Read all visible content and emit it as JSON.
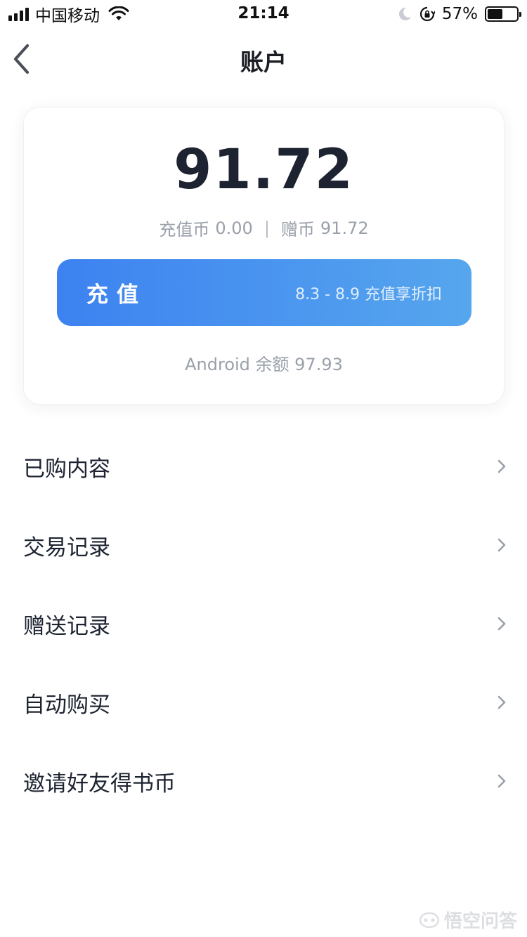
{
  "status_bar": {
    "carrier": "中国移动",
    "time": "21:14",
    "battery_percent": "57%",
    "battery_level": 0.57,
    "icons": [
      "signal-icon",
      "wifi-icon",
      "moon-icon",
      "rotation-lock-icon",
      "battery-icon"
    ]
  },
  "nav": {
    "title": "账户",
    "back_icon": "chevron-left-icon"
  },
  "account": {
    "balance": "91.72",
    "recharge_coins_label": "充值币",
    "recharge_coins_value": "0.00",
    "separator": "|",
    "gift_coins_label": "赠币",
    "gift_coins_value": "91.72",
    "recharge_button_label": "充值",
    "recharge_promo": "8.3 - 8.9 充值享折扣",
    "android_balance": "Android 余额 97.93"
  },
  "menu": {
    "items": [
      {
        "label": "已购内容"
      },
      {
        "label": "交易记录"
      },
      {
        "label": "赠送记录"
      },
      {
        "label": "自动购买"
      },
      {
        "label": "邀请好友得书币"
      }
    ]
  },
  "watermark": {
    "text": "悟空问答"
  },
  "colors": {
    "button_gradient_start": "#3d82f0",
    "button_gradient_end": "#56a6ee",
    "text_primary": "#1d2330",
    "text_secondary": "#9aa0aa"
  }
}
